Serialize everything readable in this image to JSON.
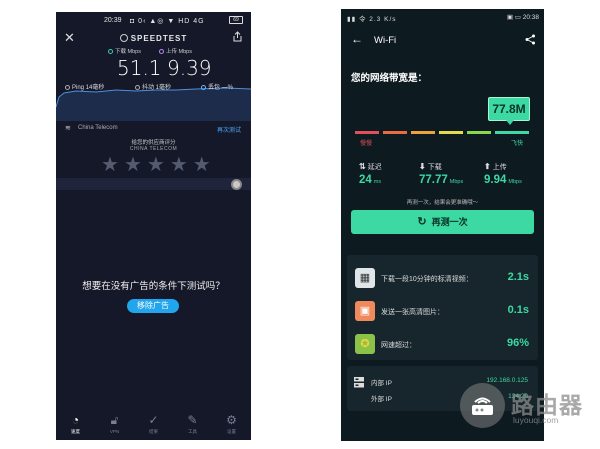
{
  "left": {
    "status_time": "20:39",
    "status_icons": "◘ 0‹ ▲◎ ▼ HD 4G",
    "status_battery": "69",
    "app_title": "SPEEDTEST",
    "download_label": "下载 Mbps",
    "upload_label": "上传 Mbps",
    "download_value": "51.1",
    "upload_value": "9.39",
    "ping": "Ping 14毫秒",
    "jitter": "抖动  1毫秒",
    "loss": "丢包  —%",
    "isp": "China Telecom",
    "retest": "再次测试",
    "rate_prompt": "给您的供应商评分",
    "rate_isp": "CHINA TELECOM",
    "ad_prompt": "想要在没有广告的条件下测试吗？",
    "ad_button": "移除广告",
    "nav": [
      {
        "label": "速度",
        "icon": "speed-icon"
      },
      {
        "label": "VPN",
        "icon": "lock-icon"
      },
      {
        "label": "结果",
        "icon": "results-icon"
      },
      {
        "label": "工具",
        "icon": "tools-icon"
      },
      {
        "label": "设置",
        "icon": "settings-icon"
      }
    ],
    "colors": {
      "download": "#34d1a9",
      "upload": "#b985f7",
      "accent": "#21a5ec"
    }
  },
  "right": {
    "status_left": "▮▮ 令 2.3 K/s",
    "status_right": "▣ ▭ 20:38",
    "title": "Wi-Fi",
    "heading": "您的网络带宽是：",
    "speed_badge": "77.8M",
    "slow_label": "慢慢",
    "fast_label": "飞快",
    "latency_label": "延迟",
    "latency_value": "24",
    "latency_unit": "ms",
    "download_label": "下载",
    "download_value": "77.77",
    "download_unit": "Mbps",
    "upload_label": "上传",
    "upload_value": "9.94",
    "upload_unit": "Mbps",
    "hint": "再测一次，结果会更准确哦～",
    "retest": "再测一次",
    "rows": [
      {
        "label": "下载一段10分钟的标清视频：",
        "value": "2.1s"
      },
      {
        "label": "发送一张高清图片：",
        "value": "0.1s"
      },
      {
        "label": "网速超过：",
        "value": "96%"
      }
    ],
    "internal_ip_label": "内部 IP",
    "internal_ip": "192.168.0.125",
    "external_ip_label": "外部 IP",
    "external_ip": "124.20",
    "colors": {
      "accent": "#3cd9a3",
      "slow": "#e0505a"
    }
  },
  "watermark": {
    "logo_text": "路由器",
    "url": "luyouqi.com"
  }
}
